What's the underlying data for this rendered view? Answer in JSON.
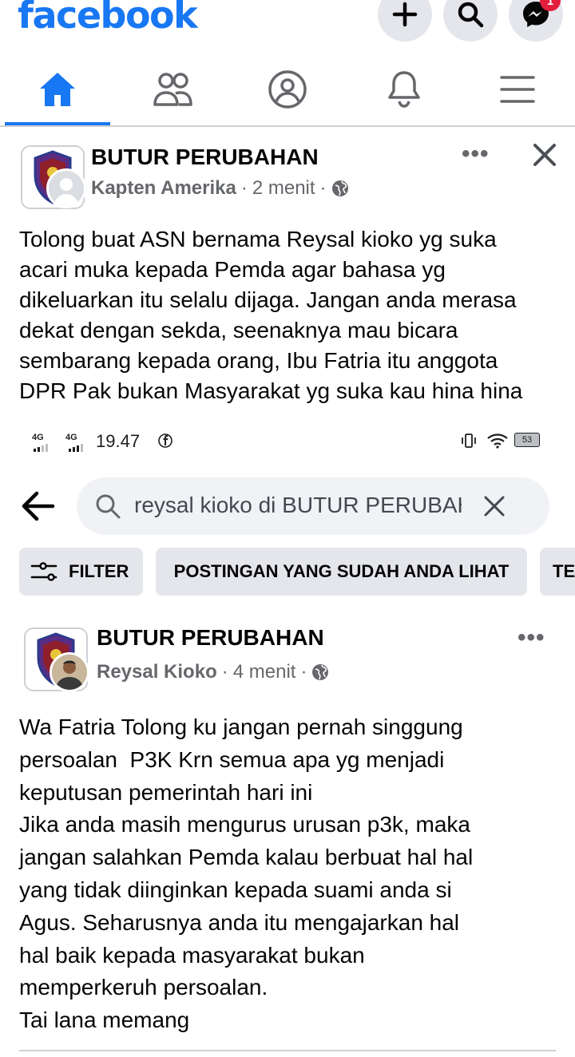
{
  "header": {
    "logo": "facebook",
    "notification_count": "1"
  },
  "nav": {
    "items": [
      "home-icon",
      "friends-icon",
      "profile-icon",
      "notifications-icon",
      "menu-icon"
    ],
    "active": "home"
  },
  "post1": {
    "page_name": "BUTUR PERUBAHAN",
    "author": "Kapten Amerika",
    "time": "2 menit",
    "text": "Tolong buat ASN bernama Reysal kioko yg suka\nacari muka kepada Pemda agar bahasa yg\ndikeluarkan itu selalu dijaga. Jangan anda merasa\ndekat dengan sekda, seenaknya mau bicara\nsembarang kepada orang, Ibu Fatria itu anggota\nDPR Pak bukan Masyarakat yg suka kau hina hina"
  },
  "status_bar": {
    "net1": "4G",
    "net2": "4G",
    "time": "19.47",
    "battery": "53"
  },
  "search": {
    "query": "reysal kioko di BUTUR PERUBAHAN"
  },
  "filters": {
    "filter_label": "FILTER",
    "chip1": "POSTINGAN YANG SUDAH ANDA LIHAT",
    "chip2": "TE"
  },
  "post2": {
    "page_name": "BUTUR PERUBAHAN",
    "author": "Reysal Kioko",
    "time": "4 menit",
    "text": "Wa Fatria Tolong ku jangan pernah singgung\npersoalan  P3K Krn semua apa yg menjadi\nkeputusan pemerintah hari ini\nJika anda masih mengurus urusan p3k, maka\njangan salahkan Pemda kalau berbuat hal hal\nyang tidak diinginkan kepada suami anda si\nAgus. Seharusnya anda itu mengajarkan hal\nhal baik kepada masyarakat bukan\nmemperkeruh persoalan.\nTai lana memang"
  },
  "colors": {
    "brand": "#1877f2",
    "text": "#050505",
    "secondary": "#65676b",
    "chip_bg": "#e4e6eb",
    "badge": "#e41e3f"
  }
}
